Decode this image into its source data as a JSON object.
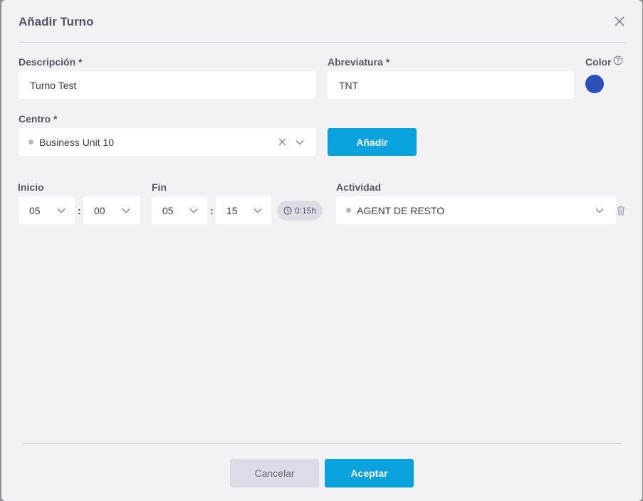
{
  "dialog": {
    "title": "Añadir Turno",
    "close_icon": "close-icon"
  },
  "form": {
    "descripcion": {
      "label": "Descripción",
      "required_mark": "*",
      "value": "Turno Test"
    },
    "abreviatura": {
      "label": "Abreviatura",
      "required_mark": "*",
      "value": "TNT"
    },
    "color": {
      "label": "Color",
      "value": "#2b50b8",
      "help_icon": "help-circle-icon"
    },
    "centro": {
      "label": "Centro",
      "required_mark": "*",
      "value": "Business Unit 10"
    },
    "add_button": "Añadir"
  },
  "shift_row": {
    "inicio_label": "Inicio",
    "fin_label": "Fin",
    "actividad_label": "Actividad",
    "inicio_hour": "05",
    "inicio_minute": "00",
    "fin_hour": "05",
    "fin_minute": "15",
    "separator": ":",
    "duration": "0:15h",
    "actividad_value": "AGENT DE RESTO"
  },
  "footer": {
    "cancel_label": "Cancelar",
    "accept_label": "Aceptar"
  },
  "colors": {
    "primary": "#0aa2dd",
    "swatch": "#2b50b8"
  }
}
